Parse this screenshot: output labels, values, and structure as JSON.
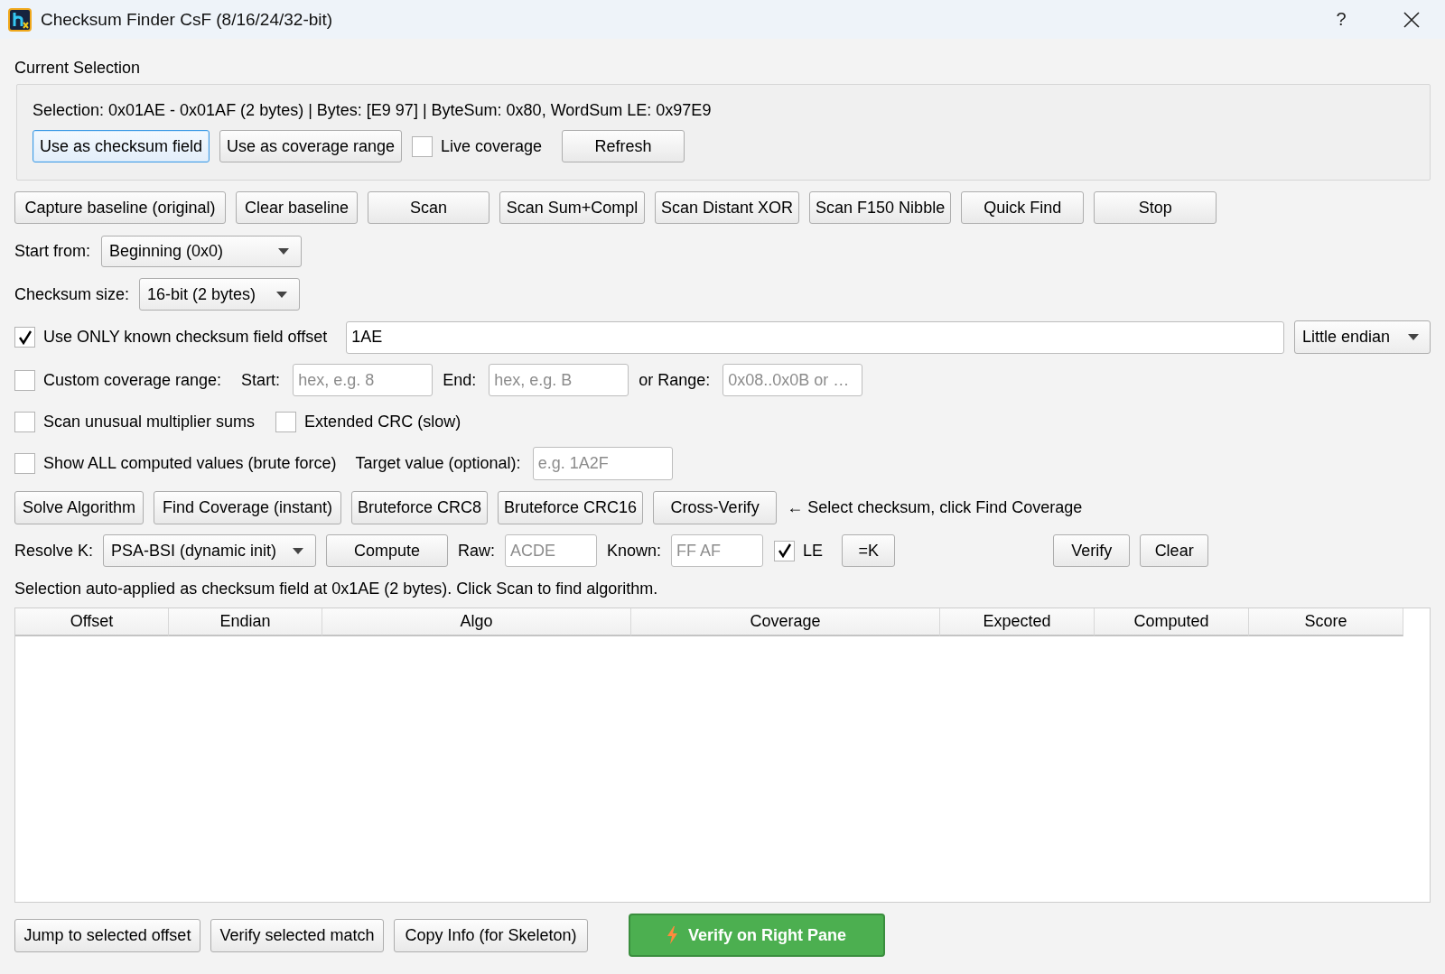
{
  "window": {
    "title": "Checksum Finder CsF (8/16/24/32-bit)",
    "help": "?"
  },
  "current_selection": {
    "label": "Current Selection",
    "info": "Selection: 0x01AE - 0x01AF (2 bytes) | Bytes: [E9 97] | ByteSum: 0x80, WordSum LE: 0x97E9",
    "buttons": [
      {
        "label": "Use as checksum field",
        "focused": true
      },
      {
        "label": "Use as coverage range",
        "focused": false
      }
    ],
    "live_coverage": {
      "label": "Live coverage",
      "checked": false
    },
    "refresh_button": "Refresh"
  },
  "scan_buttons": [
    "Capture baseline (original)",
    "Clear baseline",
    "Scan",
    "Scan Sum+Compl",
    "Scan Distant XOR",
    "Scan F150 Nibble",
    "Quick Find",
    "Stop"
  ],
  "start_from": {
    "label": "Start from:",
    "value": "Beginning (0x0)"
  },
  "checksum_size": {
    "label": "Checksum size:",
    "value": "16-bit (2 bytes)"
  },
  "known_offset": {
    "label": "Use ONLY known checksum field offset",
    "checked": true,
    "value": "1AE",
    "endian": "Little endian"
  },
  "custom_coverage": {
    "label": "Custom coverage range:",
    "checked": false,
    "start_label": "Start:",
    "start_placeholder": "hex, e.g. 8",
    "end_label": "End:",
    "end_placeholder": "hex, e.g. B",
    "range_label": "or Range:",
    "range_placeholder": "0x08..0x0B or …"
  },
  "options": [
    {
      "label": "Scan unusual multiplier sums",
      "checked": false
    },
    {
      "label": "Extended CRC (slow)",
      "checked": false
    }
  ],
  "show_all": {
    "label": "Show ALL computed values (brute force)",
    "checked": false,
    "target_label": "Target value (optional):",
    "target_placeholder": "e.g. 1A2F"
  },
  "solve_buttons": [
    "Solve Algorithm",
    "Find Coverage (instant)",
    "Bruteforce CRC8",
    "Bruteforce CRC16",
    "Cross-Verify"
  ],
  "hint": "← Select checksum, click Find Coverage",
  "resolve_k": {
    "label": "Resolve K:",
    "preset": "PSA-BSI (dynamic init)",
    "compute_button": "Compute",
    "raw_label": "Raw:",
    "raw_placeholder": "ACDE",
    "known_label": "Known:",
    "known_placeholder": "FF AF",
    "le": {
      "label": "LE",
      "checked": true
    },
    "k_button": "=K",
    "verify_button": "Verify",
    "clear_button": "Clear"
  },
  "status": "Selection auto-applied as checksum field at 0x1AE (2 bytes). Click Scan to find algorithm.",
  "results_table": {
    "columns": [
      "Offset",
      "Endian",
      "Algo",
      "Coverage",
      "Expected",
      "Computed",
      "Score"
    ]
  },
  "bottom_buttons": [
    "Jump to selected offset",
    "Verify selected match",
    "Copy Info (for Skeleton)"
  ],
  "primary_button": "Verify on Right Pane"
}
